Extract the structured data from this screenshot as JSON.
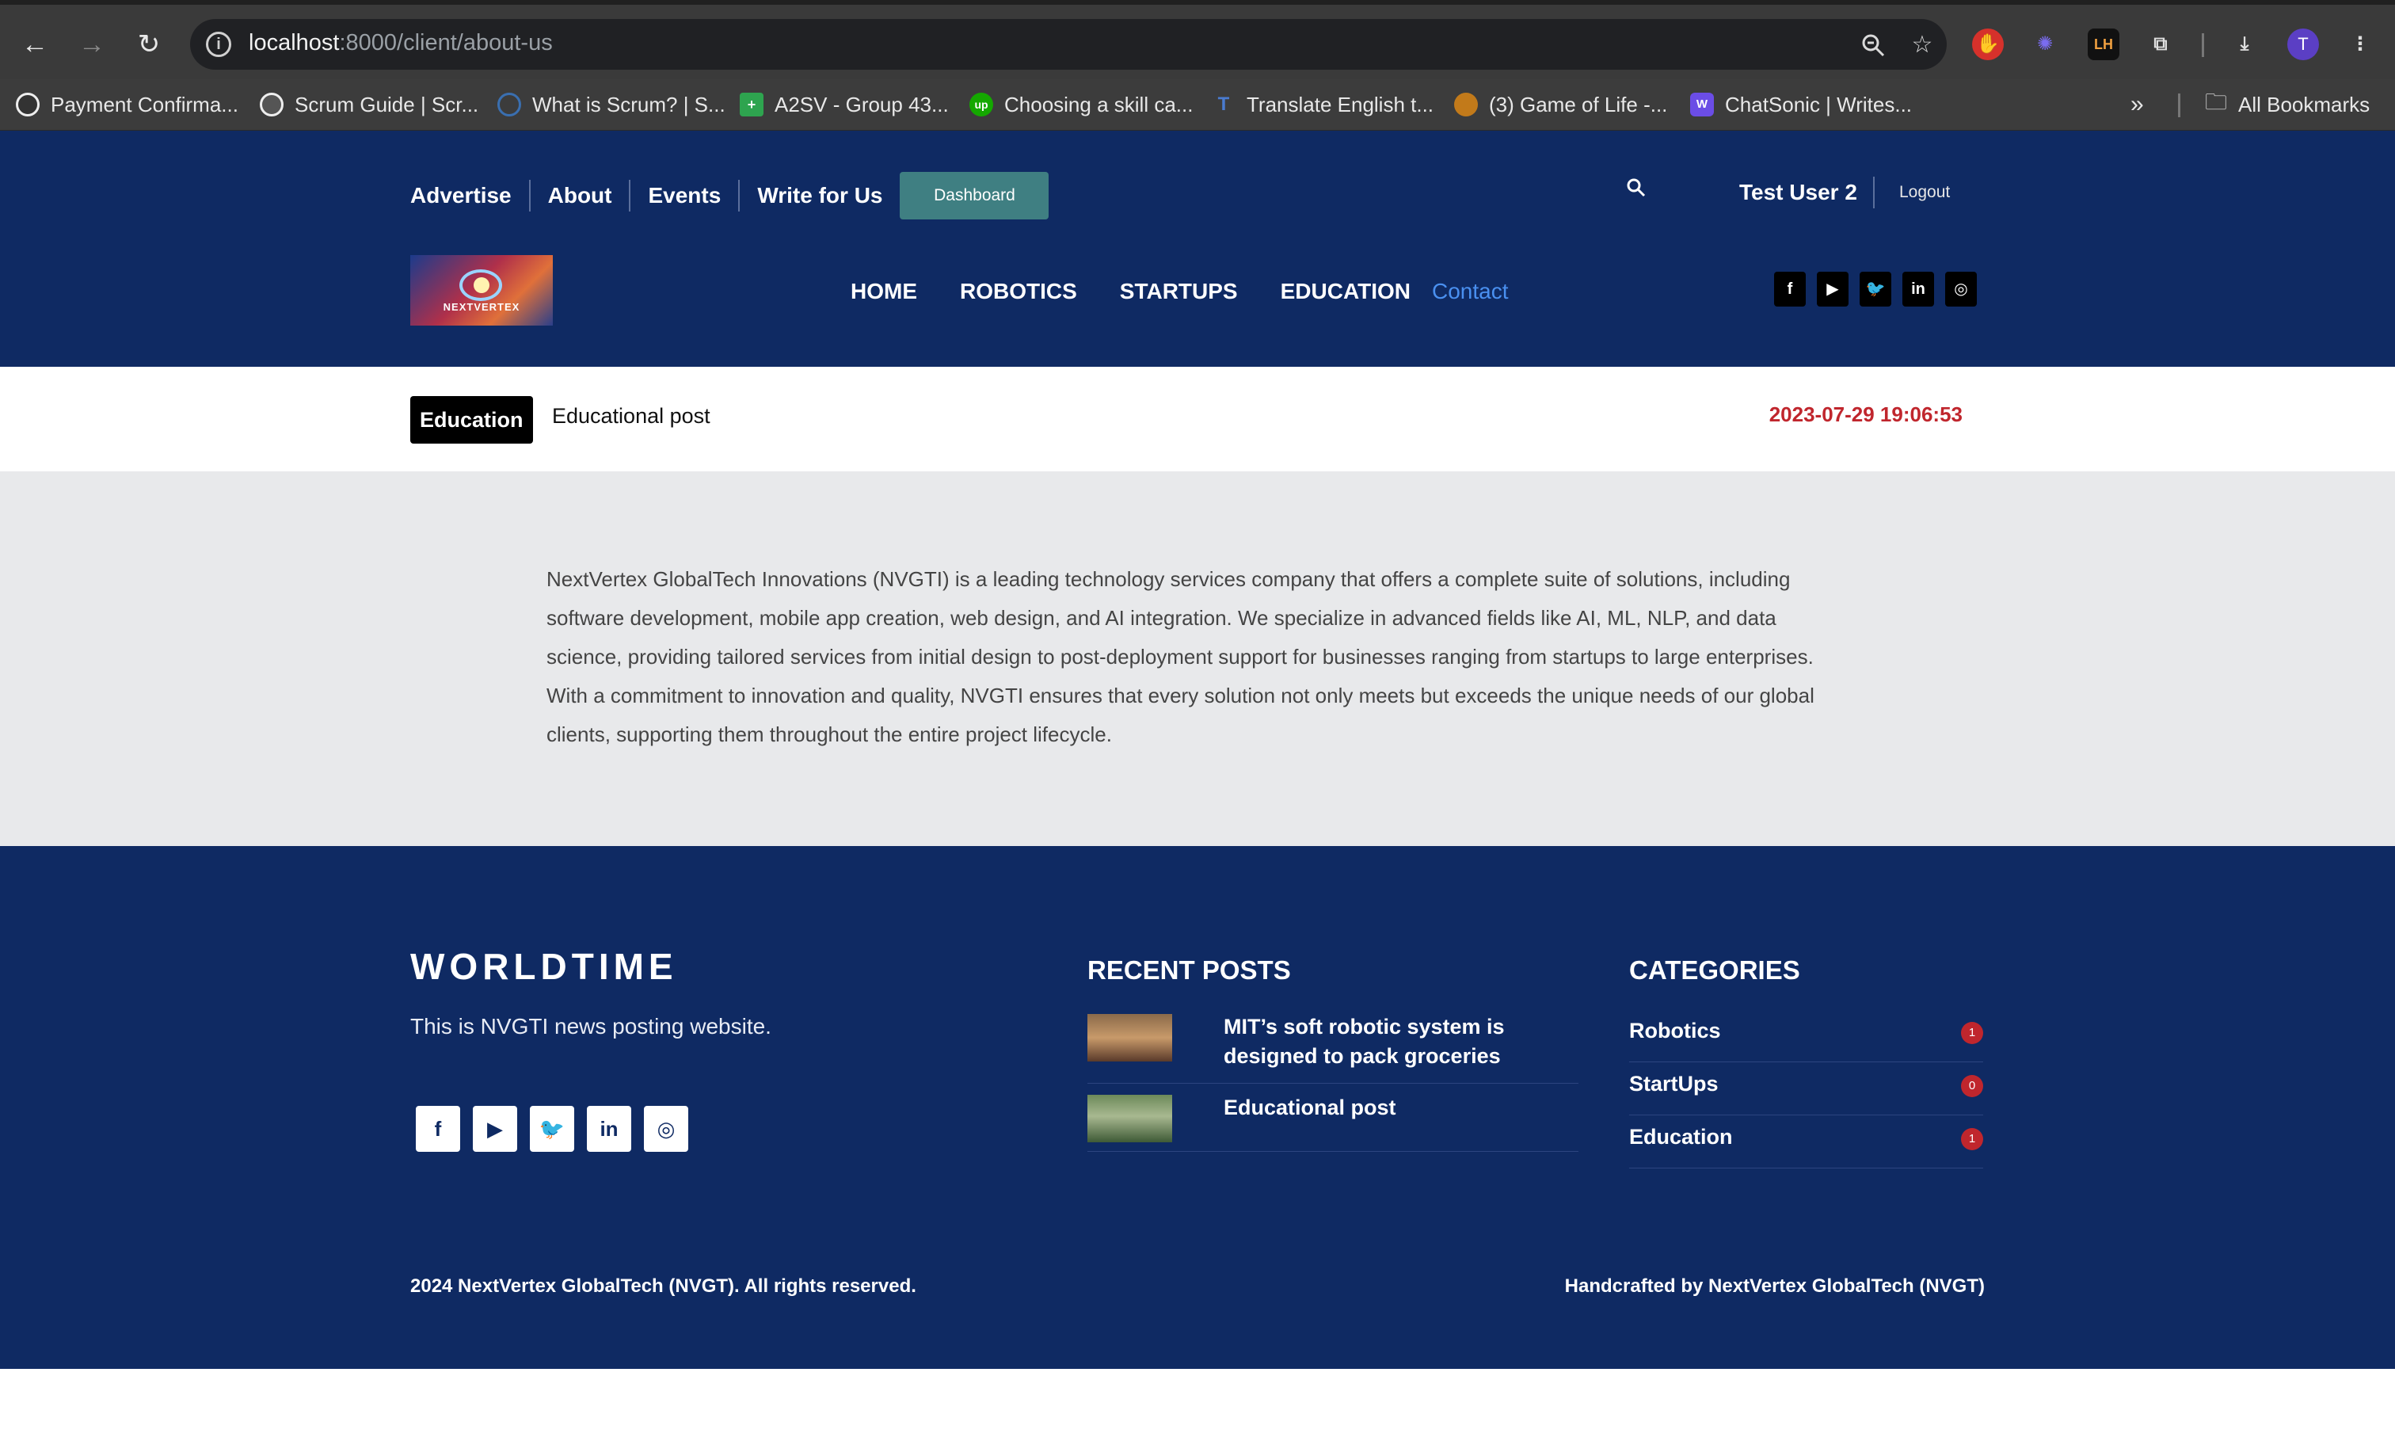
{
  "browser": {
    "url_host": "localhost",
    "url_path": ":8000/client/about-us",
    "avatar_letter": "T",
    "bookmarks": [
      {
        "label": "Payment Confirma...",
        "color": "#333333",
        "glyph": ""
      },
      {
        "label": "Scrum Guide | Scr...",
        "color": "#555555",
        "glyph": ""
      },
      {
        "label": "What is Scrum? | S...",
        "color": "#3a6fb0",
        "glyph": ""
      },
      {
        "label": "A2SV - Group 43...",
        "color": "#2ea44f",
        "glyph": "+"
      },
      {
        "label": "Choosing a skill ca...",
        "color": "#14a800",
        "glyph": "up"
      },
      {
        "label": "Translate English t...",
        "color": "#4a7bd0",
        "glyph": "T"
      },
      {
        "label": "(3) Game of Life -...",
        "color": "#c27a1a",
        "glyph": ""
      },
      {
        "label": "ChatSonic | Writes...",
        "color": "#6b4de6",
        "glyph": "W"
      }
    ],
    "all_bookmarks": "All Bookmarks"
  },
  "header": {
    "top_links": [
      "Advertise",
      "About",
      "Events",
      "Write for Us"
    ],
    "dashboard_label": "Dashboard",
    "user_name": "Test User 2",
    "logout_label": "Logout",
    "logo_text": "NEXTVERTEX",
    "main_nav": [
      "HOME",
      "ROBOTICS",
      "STARTUPS",
      "EDUCATION"
    ],
    "contact_label": "Contact",
    "social_icons": [
      "facebook-icon",
      "youtube-icon",
      "twitter-icon",
      "linkedin-icon",
      "instagram-icon"
    ]
  },
  "post": {
    "category": "Education",
    "title": "Educational post",
    "date": "2023-07-29 19:06:53",
    "body": "NextVertex GlobalTech Innovations (NVGTI) is a leading technology services company that offers a complete suite of solutions, including software development, mobile app creation, web design, and AI integration. We specialize in advanced fields like AI, ML, NLP, and data science, providing tailored services from initial design to post-deployment support for businesses ranging from startups to large enterprises. With a commitment to innovation and quality, NVGTI ensures that every solution not only meets but exceeds the unique needs of our global clients, supporting them throughout the entire project lifecycle."
  },
  "footer": {
    "brand": "WORLDTIME",
    "tagline": "This is NVGTI news posting website.",
    "recent_posts_heading": "RECENT POSTS",
    "recent_posts": [
      {
        "title": "MIT’s soft robotic system is designed to pack groceries"
      },
      {
        "title": "Educational post"
      }
    ],
    "categories_heading": "CATEGORIES",
    "categories": [
      {
        "name": "Robotics",
        "count": "1"
      },
      {
        "name": "StartUps",
        "count": "0"
      },
      {
        "name": "Education",
        "count": "1"
      }
    ],
    "copyright": "2024 NextVertex GlobalTech (NVGT). All rights reserved.",
    "credit": "Handcrafted by NextVertex GlobalTech (NVGT)"
  },
  "colors": {
    "navy": "#0f2a63",
    "dashboard_teal": "#3f7f82",
    "date_red": "#c0262d",
    "contact_blue": "#4a90f0",
    "content_gray": "#e8e9eb"
  }
}
